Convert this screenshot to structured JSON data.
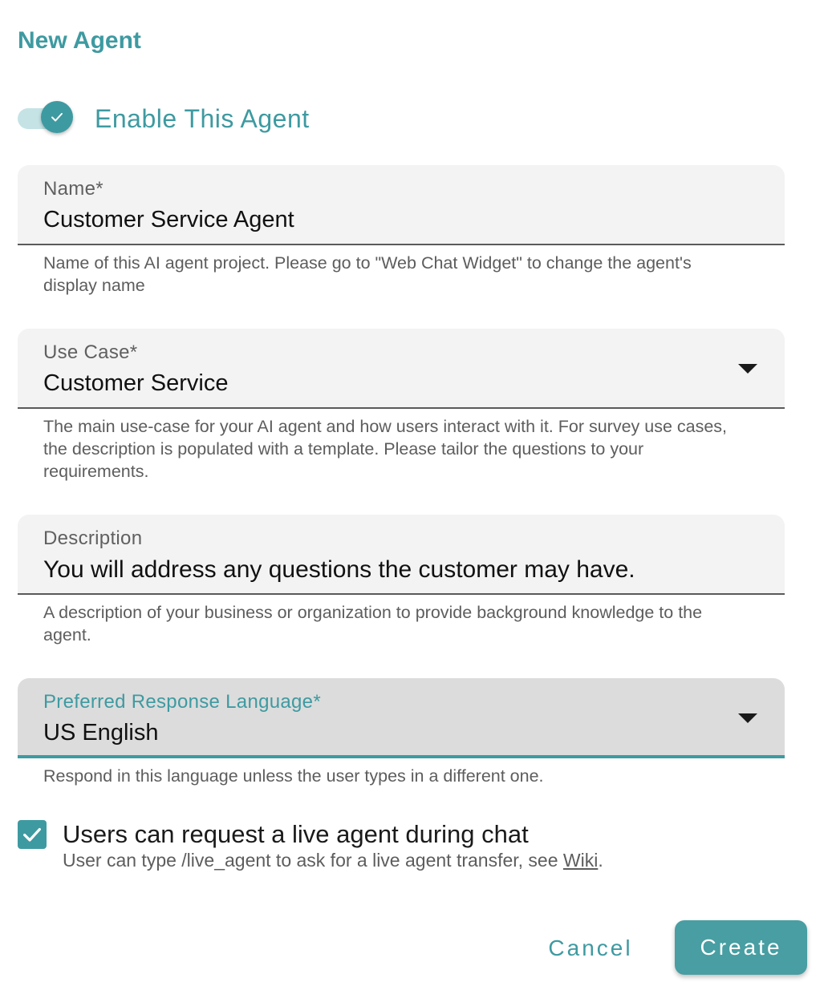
{
  "dialog": {
    "title": "New Agent"
  },
  "enable_toggle": {
    "label": "Enable This Agent",
    "checked": true
  },
  "name_field": {
    "label": "Name",
    "required_mark": "*",
    "value": "Customer Service Agent",
    "helper": "Name of this AI agent project. Please go to \"Web Chat Widget\" to change the agent's display name"
  },
  "use_case_field": {
    "label": "Use Case",
    "required_mark": "*",
    "value": "Customer Service",
    "helper": "The main use-case for your AI agent and how users interact with it. For survey use cases, the description is populated with a template. Please tailor the questions to your requirements."
  },
  "description_field": {
    "label": "Description",
    "value": "You will address any questions the customer may have.",
    "helper": "A description of your business or organization to provide background knowledge to the agent."
  },
  "language_field": {
    "label": "Preferred Response Language",
    "required_mark": "*",
    "value": "US English",
    "helper": "Respond in this language unless the user types in a different one."
  },
  "live_agent": {
    "label": "Users can request a live agent during chat",
    "checked": true,
    "helper_prefix": "User can type /live_agent to ask for a live agent transfer, see ",
    "helper_link": "Wiki",
    "helper_suffix": "."
  },
  "actions": {
    "cancel_label": "Cancel",
    "create_label": "Create"
  },
  "colors": {
    "accent": "#3e9aa1",
    "field_bg": "#f3f3f3",
    "field_focused_bg": "#dcdcdc",
    "helper_text": "#5d5d5d"
  }
}
